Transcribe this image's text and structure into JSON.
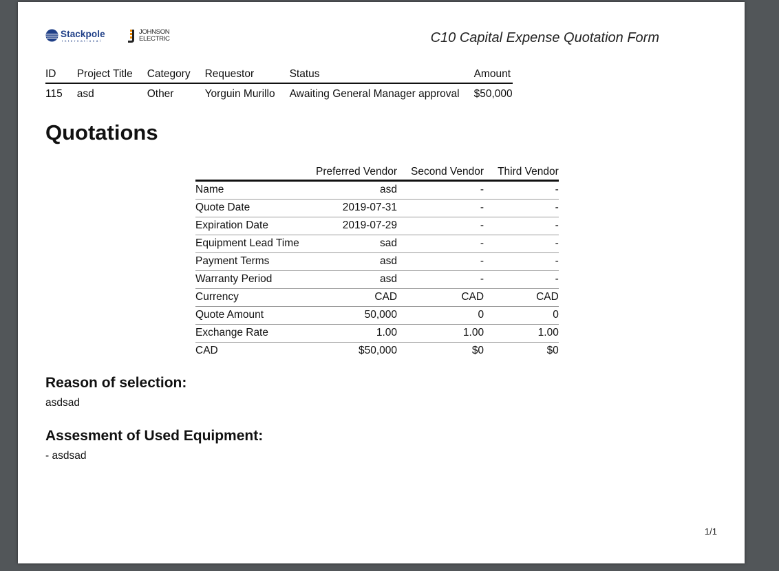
{
  "header": {
    "logo_stackpole": "Stackpole",
    "logo_stackpole_sub": "International",
    "logo_johnson_line1": "JOHNSON",
    "logo_johnson_line2": "ELECTRIC",
    "form_title": "C10 Capital Expense Quotation Form"
  },
  "summary": {
    "columns": [
      "ID",
      "Project Title",
      "Category",
      "Requestor",
      "Status",
      "Amount"
    ],
    "row": {
      "id": "115",
      "project_title": "asd",
      "category": "Other",
      "requestor": "Yorguin Murillo",
      "status": "Awaiting General Manager approval",
      "amount": "$50,000"
    }
  },
  "quotations": {
    "heading": "Quotations",
    "columns": [
      "Preferred Vendor",
      "Second Vendor",
      "Third Vendor"
    ],
    "rows": [
      {
        "label": "Name",
        "values": [
          "asd",
          "-",
          "-"
        ]
      },
      {
        "label": "Quote Date",
        "values": [
          "2019-07-31",
          "-",
          "-"
        ]
      },
      {
        "label": "Expiration Date",
        "values": [
          "2019-07-29",
          "-",
          "-"
        ]
      },
      {
        "label": "Equipment Lead Time",
        "values": [
          "sad",
          "-",
          "-"
        ]
      },
      {
        "label": "Payment Terms",
        "values": [
          "asd",
          "-",
          "-"
        ]
      },
      {
        "label": "Warranty Period",
        "values": [
          "asd",
          "-",
          "-"
        ]
      },
      {
        "label": "Currency",
        "values": [
          "CAD",
          "CAD",
          "CAD"
        ]
      },
      {
        "label": "Quote Amount",
        "values": [
          "50,000",
          "0",
          "0"
        ]
      },
      {
        "label": "Exchange Rate",
        "values": [
          "1.00",
          "1.00",
          "1.00"
        ]
      },
      {
        "label": "CAD",
        "values": [
          "$50,000",
          "$0",
          "$0"
        ]
      }
    ]
  },
  "reason": {
    "heading": "Reason of selection:",
    "text": "asdsad"
  },
  "assessment": {
    "heading": "Assesment of Used Equipment:",
    "text": "- asdsad"
  },
  "footer": {
    "page_number": "1/1"
  },
  "colors": {
    "viewer_background": "#525659",
    "page_background": "#ffffff",
    "stackpole_blue": "#1f3f87",
    "johnson_orange": "#f08a00"
  }
}
